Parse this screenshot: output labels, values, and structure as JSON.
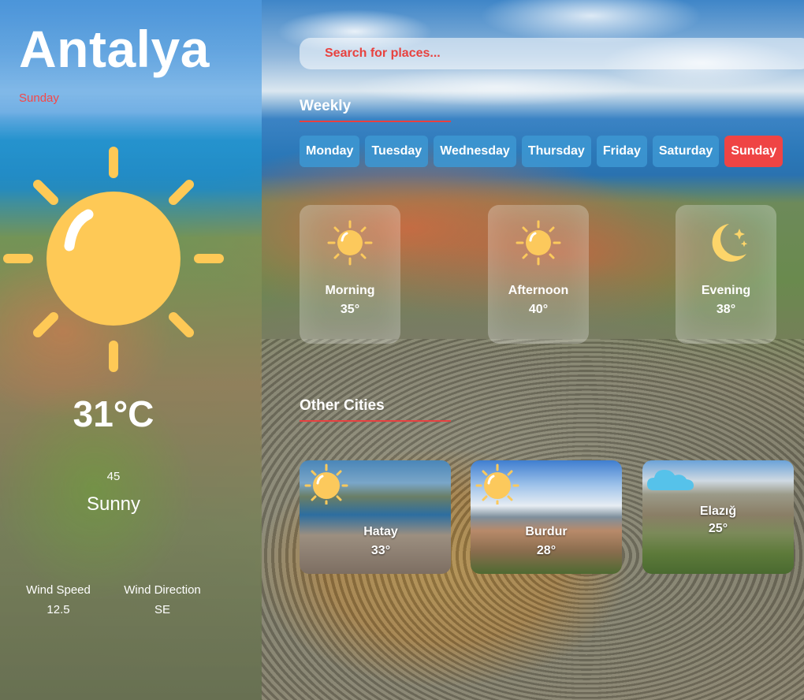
{
  "city": {
    "name": "Antalya",
    "day": "Sunday"
  },
  "current": {
    "temperature": "31°C",
    "humidity": "45",
    "condition": "Sunny",
    "icon": "sun-icon"
  },
  "wind": {
    "speed_label": "Wind Speed",
    "speed_value": "12.5",
    "direction_label": "Wind Direction",
    "direction_value": "SE"
  },
  "search": {
    "placeholder": "Search for places..."
  },
  "weekly": {
    "title": "Weekly",
    "days": [
      {
        "label": "Monday",
        "active": false
      },
      {
        "label": "Tuesday",
        "active": false
      },
      {
        "label": "Wednesday",
        "active": false
      },
      {
        "label": "Thursday",
        "active": false
      },
      {
        "label": "Friday",
        "active": false
      },
      {
        "label": "Saturday",
        "active": false
      },
      {
        "label": "Sunday",
        "active": true
      }
    ]
  },
  "periods": [
    {
      "label": "Morning",
      "temp": "35°",
      "icon": "sun-icon"
    },
    {
      "label": "Afternoon",
      "temp": "40°",
      "icon": "sun-icon"
    },
    {
      "label": "Evening",
      "temp": "38°",
      "icon": "moon-stars-icon"
    }
  ],
  "other_cities": {
    "title": "Other Cities",
    "items": [
      {
        "name": "Hatay",
        "temp": "33°",
        "icon": "sun-icon"
      },
      {
        "name": "Burdur",
        "temp": "28°",
        "icon": "sun-icon"
      },
      {
        "name": "Elazığ",
        "temp": "25°",
        "icon": "cloud-icon"
      }
    ]
  },
  "colors": {
    "accent": "#ef4444",
    "tab": "#3c96d2",
    "sun": "#fcc95c"
  }
}
